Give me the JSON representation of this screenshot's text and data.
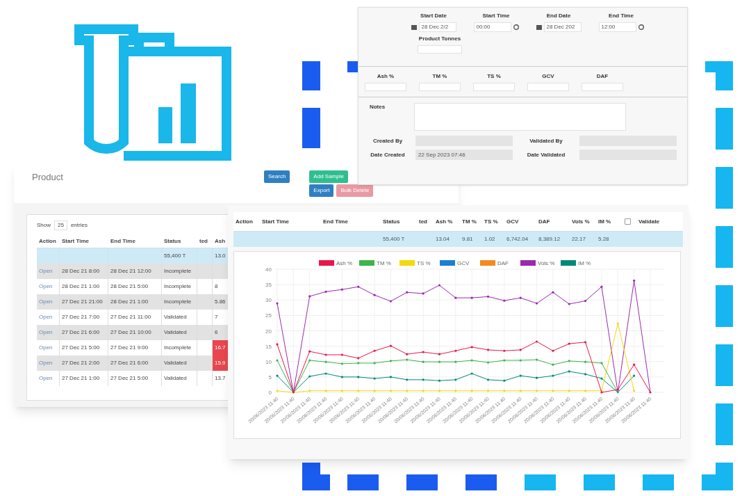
{
  "form_panel": {
    "fields": [
      {
        "label": "Start Date",
        "value": "28 Dec 2/2"
      },
      {
        "label": "Start Time",
        "value": "00:00"
      },
      {
        "label": "End Date",
        "value": "28 Dec 202"
      },
      {
        "label": "End Time",
        "value": "12:00"
      }
    ],
    "tonnes": {
      "label": "Product Tonnes"
    },
    "measures": [
      "Ash %",
      "TM %",
      "TS %",
      "GCV",
      "DAF"
    ],
    "notes": {
      "label": "Notes"
    },
    "meta": [
      {
        "label": "Created By"
      },
      {
        "label": "Validated By"
      },
      {
        "label": "Date Created",
        "value": "22 Sep 2023 07:46"
      },
      {
        "label": "Date Validated"
      }
    ]
  },
  "product_panel": {
    "title": "Product",
    "buttons": [
      {
        "label": "Search",
        "kind": "primary"
      },
      {
        "label": "Add Sample",
        "kind": "success"
      },
      {
        "label": "Export",
        "kind": "primary"
      },
      {
        "label": "Bulk Delete",
        "kind": "danger"
      }
    ],
    "show_entries": {
      "before": "Show",
      "value": "25",
      "after": "entries"
    },
    "columns": [
      "Action",
      "Start Time",
      "End Time",
      "Status",
      "ted",
      "Ash"
    ],
    "rows": [
      {
        "kind": "total",
        "status": "55,400 T",
        "ash": "13.0",
        "flagged": false
      },
      {
        "kind": "data",
        "action": "Open",
        "start": "28 Dec 21 8:00",
        "end": "28 Dec 21 12:00",
        "status": "Incomplete",
        "flagged": false
      },
      {
        "kind": "data",
        "action": "Open",
        "start": "28 Dec 21 1:00",
        "end": "28 Dec 21 5:00",
        "status": "Incomplete",
        "ash": "8",
        "flagged": false
      },
      {
        "kind": "data",
        "action": "Open",
        "start": "27 Dec 21 21:00",
        "end": "28 Dec 21 1:00",
        "status": "Incomplete",
        "ash": "5.86",
        "flagged": false
      },
      {
        "kind": "data",
        "action": "Open",
        "start": "27 Dec 21 7:00",
        "end": "27 Dec 21 11:00",
        "status": "Validated",
        "ash": "7",
        "flagged": false
      },
      {
        "kind": "data",
        "action": "Open",
        "start": "27 Dec 21 6:00",
        "end": "27 Dec 21 10:00",
        "status": "Validated",
        "ash": "6",
        "flagged": false
      },
      {
        "kind": "data",
        "action": "Open",
        "start": "27 Dec 21 5:00",
        "end": "27 Dec 21 9:00",
        "status": "Incomplete",
        "ash": "16.7",
        "flagged": true
      },
      {
        "kind": "data",
        "action": "Open",
        "start": "27 Dec 21 2:00",
        "end": "27 Dec 21 6:00",
        "status": "Validated",
        "ash": "15.9",
        "flagged": true
      },
      {
        "kind": "data",
        "action": "Open",
        "start": "27 Dec 21 1:00",
        "end": "27 Dec 21 5:00",
        "status": "Validated",
        "ash": "13.7",
        "flagged": false
      }
    ]
  },
  "chart_panel": {
    "columns": [
      "Action",
      "Start Time",
      "End Time",
      "Status",
      "ted",
      "Ash %",
      "TM %",
      "TS %",
      "GCV",
      "DAF",
      "Vols %",
      "IM %",
      "Validate"
    ],
    "select_all": {
      "checked": false
    },
    "total_row": {
      "status": "55,400 T",
      "ash": "13.04",
      "tm": "9.81",
      "ts": "1.02",
      "gcv": "6,742.04",
      "daf": "8,389.12",
      "vols": "22.17",
      "im": "5.28"
    },
    "chart_data": {
      "type": "line",
      "grid": true,
      "legend": true,
      "categories": [
        "20/06/2023 11:40",
        "20/06/2023 11:40",
        "20/06/2023 11:40",
        "20/06/2023 11:40",
        "20/06/2023 11:40",
        "20/06/2023 11:40",
        "20/06/2023 11:40",
        "20/06/2023 11:40",
        "20/06/2023 11:40",
        "20/06/2023 11:40",
        "20/06/2023 11:40",
        "20/06/2023 11:40",
        "20/06/2023 11:40",
        "20/06/2023 11:40",
        "20/06/2023 11:40",
        "20/06/2023 11:40",
        "20/06/2023 11:40",
        "20/06/2023 11:40",
        "20/06/2023 11:40",
        "20/06/2023 11:40",
        "20/06/2023 11:40",
        "20/06/2023 11:40",
        "20/06/2023 11:40",
        "20/06/2023 11:40"
      ],
      "ylim": [
        0,
        40
      ],
      "yticks": [
        0,
        5,
        10,
        15,
        20,
        25,
        30,
        35,
        40
      ],
      "series": [
        {
          "name": "Ash %",
          "color": "#e8174a",
          "values": [
            15.6,
            0,
            13.3,
            12.2,
            12.2,
            11.1,
            13.5,
            15.1,
            12.4,
            13.1,
            12.4,
            13.5,
            14.7,
            13.8,
            13.5,
            13.8,
            16.5,
            13.5,
            15.8,
            16.3,
            0,
            0.9,
            9.0,
            0
          ]
        },
        {
          "name": "TM %",
          "color": "#3cb54a",
          "values": [
            10.4,
            0,
            10.4,
            9.9,
            9.3,
            9.5,
            9.5,
            10.2,
            10.6,
            9.9,
            9.9,
            9.9,
            10.4,
            9.7,
            10.4,
            10.4,
            10.6,
            9.0,
            10.2,
            9.9,
            9.5,
            0,
            null,
            null
          ]
        },
        {
          "name": "TS %",
          "color": "#f5d90a",
          "values": [
            0.5,
            0,
            0.5,
            0.5,
            0.5,
            0.5,
            0.5,
            0.5,
            0.5,
            0.5,
            0.5,
            0.5,
            0.5,
            0.5,
            0.5,
            0.5,
            0.5,
            0.5,
            0.5,
            0.5,
            0.5,
            22.3,
            0.5,
            null
          ]
        },
        {
          "name": "GCV",
          "color": "#1e7fd0",
          "values": [
            null,
            null,
            null,
            null,
            null,
            null,
            null,
            null,
            null,
            null,
            null,
            null,
            null,
            null,
            null,
            null,
            null,
            null,
            null,
            null,
            null,
            null,
            null,
            null
          ]
        },
        {
          "name": "DAF",
          "color": "#f58a1f",
          "values": [
            null,
            null,
            null,
            null,
            null,
            null,
            null,
            null,
            null,
            null,
            null,
            null,
            null,
            null,
            null,
            null,
            null,
            null,
            null,
            null,
            null,
            null,
            null,
            null
          ]
        },
        {
          "name": "Vols %",
          "color": "#9c27b0",
          "values": [
            28.9,
            0,
            31.2,
            32.7,
            33.4,
            34.3,
            31.6,
            29.6,
            32.5,
            32.1,
            34.8,
            30.7,
            30.7,
            31.1,
            29.8,
            30.7,
            28.9,
            32.5,
            28.7,
            29.7,
            34.3,
            0,
            36.3,
            0
          ]
        },
        {
          "name": "IM %",
          "color": "#00897b",
          "values": [
            5.4,
            0,
            5.2,
            6.1,
            5.0,
            5.0,
            4.5,
            5.0,
            4.1,
            4.1,
            3.8,
            4.1,
            6.1,
            4.1,
            3.8,
            5.4,
            4.7,
            5.4,
            6.8,
            5.9,
            4.5,
            0,
            5.4,
            null
          ]
        }
      ]
    }
  }
}
